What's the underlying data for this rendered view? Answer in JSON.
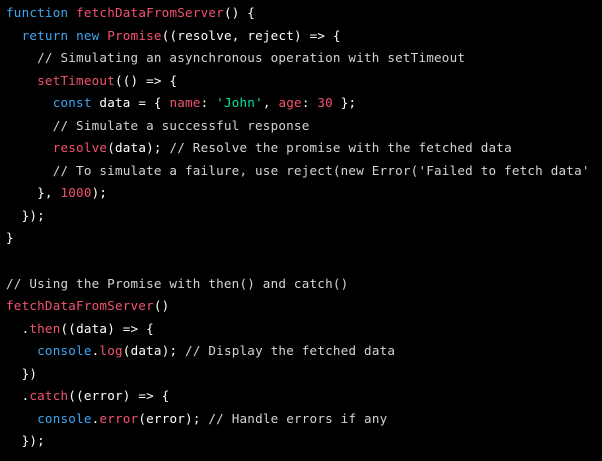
{
  "colors": {
    "background": "#000000",
    "keyword": "#3da6f4",
    "function": "#f4526f",
    "default": "#ffffff",
    "comment": "#d4d4d4",
    "property": "#f4526f",
    "string": "#00e2a2",
    "number": "#f4526f"
  },
  "code": {
    "lines": [
      [
        [
          "keyword",
          "function"
        ],
        [
          "default",
          " "
        ],
        [
          "function",
          "fetchDataFromServer"
        ],
        [
          "default",
          "() {"
        ]
      ],
      [
        [
          "default",
          "  "
        ],
        [
          "keyword",
          "return"
        ],
        [
          "default",
          " "
        ],
        [
          "keyword",
          "new"
        ],
        [
          "default",
          " "
        ],
        [
          "function",
          "Promise"
        ],
        [
          "default",
          "((resolve, reject) => {"
        ]
      ],
      [
        [
          "comment",
          "    // Simulating an asynchronous operation with setTimeout"
        ]
      ],
      [
        [
          "default",
          "    "
        ],
        [
          "function",
          "setTimeout"
        ],
        [
          "default",
          "(() => {"
        ]
      ],
      [
        [
          "default",
          "      "
        ],
        [
          "keyword",
          "const"
        ],
        [
          "default",
          " data = { "
        ],
        [
          "property",
          "name"
        ],
        [
          "default",
          ": "
        ],
        [
          "string",
          "'John'"
        ],
        [
          "default",
          ", "
        ],
        [
          "property",
          "age"
        ],
        [
          "default",
          ": "
        ],
        [
          "number",
          "30"
        ],
        [
          "default",
          " };"
        ]
      ],
      [
        [
          "comment",
          "      // Simulate a successful response"
        ]
      ],
      [
        [
          "default",
          "      "
        ],
        [
          "function",
          "resolve"
        ],
        [
          "default",
          "(data); "
        ],
        [
          "comment",
          "// Resolve the promise with the fetched data"
        ]
      ],
      [
        [
          "comment",
          "      // To simulate a failure, use reject(new Error('Failed to fetch data'"
        ]
      ],
      [
        [
          "default",
          "    }, "
        ],
        [
          "number",
          "1000"
        ],
        [
          "default",
          ");"
        ]
      ],
      [
        [
          "default",
          "  });"
        ]
      ],
      [
        [
          "default",
          "}"
        ]
      ],
      [],
      [
        [
          "comment",
          "// Using the Promise with then() and catch()"
        ]
      ],
      [
        [
          "function",
          "fetchDataFromServer"
        ],
        [
          "default",
          "()"
        ]
      ],
      [
        [
          "default",
          "  ."
        ],
        [
          "function",
          "then"
        ],
        [
          "default",
          "((data) => {"
        ]
      ],
      [
        [
          "default",
          "    "
        ],
        [
          "keyword",
          "console"
        ],
        [
          "default",
          "."
        ],
        [
          "function",
          "log"
        ],
        [
          "default",
          "(data); "
        ],
        [
          "comment",
          "// Display the fetched data"
        ]
      ],
      [
        [
          "default",
          "  })"
        ]
      ],
      [
        [
          "default",
          "  ."
        ],
        [
          "function",
          "catch"
        ],
        [
          "default",
          "((error) => {"
        ]
      ],
      [
        [
          "default",
          "    "
        ],
        [
          "keyword",
          "console"
        ],
        [
          "default",
          "."
        ],
        [
          "function",
          "error"
        ],
        [
          "default",
          "(error); "
        ],
        [
          "comment",
          "// Handle errors if any"
        ]
      ],
      [
        [
          "default",
          "  });"
        ]
      ]
    ]
  }
}
